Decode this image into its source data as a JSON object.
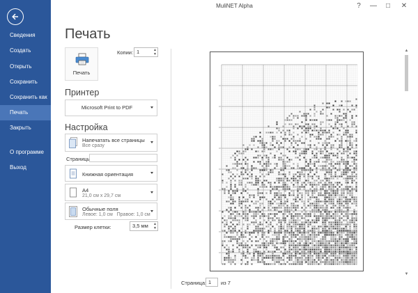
{
  "app": {
    "title": "MuliNET Alpha"
  },
  "window_controls": {
    "help": "?",
    "minimize": "—",
    "restore": "□",
    "close": "✕"
  },
  "sidebar": {
    "items": [
      {
        "label": "Сведения",
        "active": false
      },
      {
        "label": "Создать",
        "active": false
      },
      {
        "label": "Открыть",
        "active": false
      },
      {
        "label": "Сохранить",
        "active": false
      },
      {
        "label": "Сохранить как",
        "active": false
      },
      {
        "label": "Печать",
        "active": true
      },
      {
        "label": "Закрыть",
        "active": false
      },
      {
        "label": "О программе",
        "active": false
      },
      {
        "label": "Выход",
        "active": false
      }
    ]
  },
  "print": {
    "title": "Печать",
    "button_label": "Печать",
    "copies_label": "Копии:",
    "copies_value": "1"
  },
  "printer": {
    "header": "Принтер",
    "selected": "Microsoft Print to PDF"
  },
  "settings": {
    "header": "Настройка",
    "pages_mode_main": "Напечатать все страницы",
    "pages_mode_sub": "Все сразу",
    "pages_label": "Страницы:",
    "pages_value": "",
    "orientation": "Книжная ориентация",
    "paper_main": "А4",
    "paper_sub": "21,0 см x 29,7 см",
    "margins_main": "Обычные поля",
    "margins_sub": "Левое: 1,0 см   Правое: 1,0 см",
    "cell_size_label": "Размер клетки:",
    "cell_size_value": "3,5 мм"
  },
  "preview": {
    "page_label": "Страница:",
    "page_value": "1",
    "page_of": "из 7"
  },
  "colors": {
    "sidebar": "#2b579a",
    "sidebar_active": "#4a76b8"
  }
}
